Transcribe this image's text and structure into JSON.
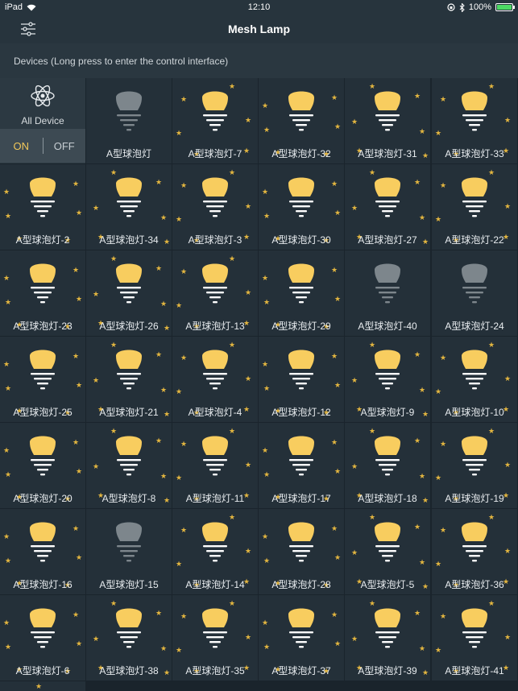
{
  "status_bar": {
    "carrier": "iPad",
    "time": "12:10",
    "battery": "100%"
  },
  "nav": {
    "title": "Mesh Lamp"
  },
  "subheader": {
    "text": "Devices (Long press to enter the control interface)"
  },
  "all_device": {
    "label": "All Device",
    "on_label": "ON",
    "off_label": "OFF"
  },
  "colors": {
    "bulb_on": "#f8cd5f",
    "bulb_off": "#7d868c",
    "accent": "#f1c75a",
    "background": "#1f2b34",
    "cell": "#243039"
  },
  "devices": [
    {
      "name": "A型球泡灯",
      "on": false
    },
    {
      "name": "A型球泡灯-7",
      "on": true
    },
    {
      "name": "A型球泡灯-32",
      "on": true
    },
    {
      "name": "A型球泡灯-31",
      "on": true
    },
    {
      "name": "A型球泡灯-33",
      "on": true
    },
    {
      "name": "A型球泡灯-2",
      "on": true
    },
    {
      "name": "A型球泡灯-34",
      "on": true
    },
    {
      "name": "A型球泡灯-3",
      "on": true
    },
    {
      "name": "A型球泡灯-30",
      "on": true
    },
    {
      "name": "A型球泡灯-27",
      "on": true
    },
    {
      "name": "A型球泡灯-22",
      "on": true
    },
    {
      "name": "A型球泡灯-23",
      "on": true
    },
    {
      "name": "A型球泡灯-26",
      "on": true
    },
    {
      "name": "A型球泡灯-13",
      "on": true
    },
    {
      "name": "A型球泡灯-29",
      "on": true
    },
    {
      "name": "A型球泡灯-40",
      "on": false
    },
    {
      "name": "A型球泡灯-24",
      "on": false
    },
    {
      "name": "A型球泡灯-25",
      "on": true
    },
    {
      "name": "A型球泡灯-21",
      "on": true
    },
    {
      "name": "A型球泡灯-4",
      "on": true
    },
    {
      "name": "A型球泡灯-12",
      "on": true
    },
    {
      "name": "A型球泡灯-9",
      "on": true
    },
    {
      "name": "A型球泡灯-10",
      "on": true
    },
    {
      "name": "A型球泡灯-20",
      "on": true
    },
    {
      "name": "A型球泡灯-8",
      "on": true
    },
    {
      "name": "A型球泡灯-11",
      "on": true
    },
    {
      "name": "A型球泡灯-17",
      "on": true
    },
    {
      "name": "A型球泡灯-18",
      "on": true
    },
    {
      "name": "A型球泡灯-19",
      "on": true
    },
    {
      "name": "A型球泡灯-16",
      "on": true
    },
    {
      "name": "A型球泡灯-15",
      "on": false
    },
    {
      "name": "A型球泡灯-14",
      "on": true
    },
    {
      "name": "A型球泡灯-28",
      "on": true
    },
    {
      "name": "A型球泡灯-5",
      "on": true
    },
    {
      "name": "A型球泡灯-36",
      "on": true
    },
    {
      "name": "A型球泡灯-6",
      "on": true
    },
    {
      "name": "A型球泡灯-38",
      "on": true
    },
    {
      "name": "A型球泡灯-35",
      "on": true
    },
    {
      "name": "A型球泡灯-37",
      "on": true
    },
    {
      "name": "A型球泡灯-39",
      "on": true
    },
    {
      "name": "A型球泡灯-41",
      "on": true
    }
  ]
}
